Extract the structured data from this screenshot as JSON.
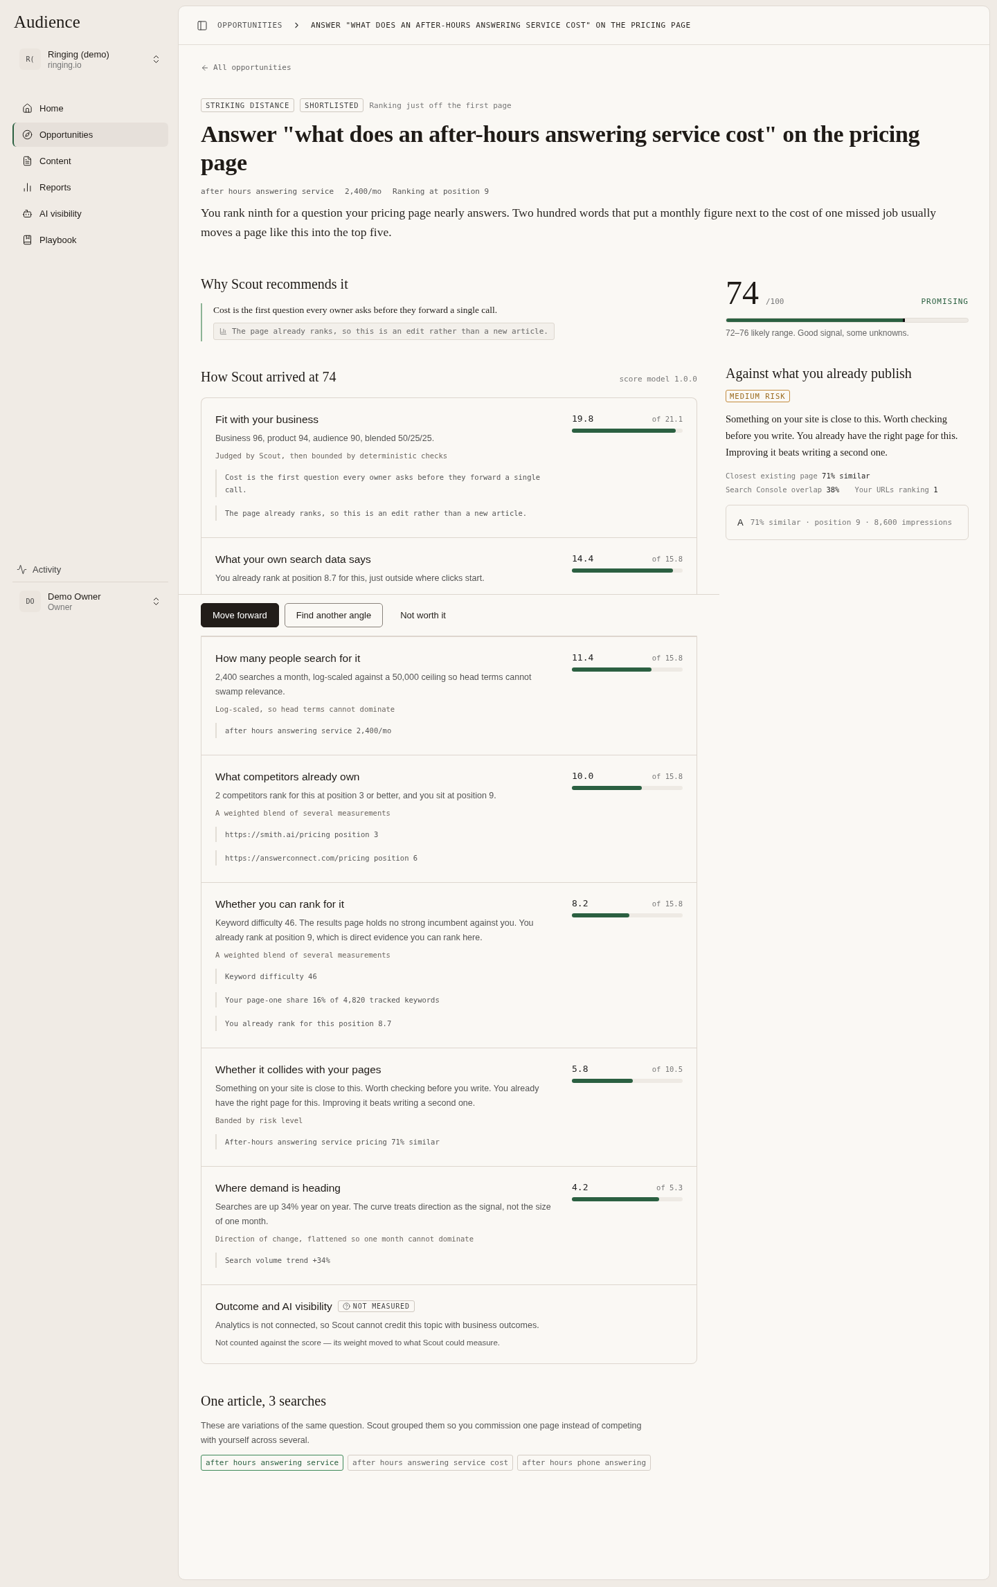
{
  "sidebar": {
    "brand": "Audience",
    "workspace": {
      "initials": "R(",
      "name": "Ringing (demo)",
      "domain": "ringing.io"
    },
    "nav": [
      {
        "label": "Home",
        "selected": false
      },
      {
        "label": "Opportunities",
        "selected": true
      },
      {
        "label": "Content",
        "selected": false
      },
      {
        "label": "Reports",
        "selected": false
      },
      {
        "label": "AI visibility",
        "selected": false
      },
      {
        "label": "Playbook",
        "selected": false
      }
    ],
    "activity": "Activity",
    "user": {
      "initials": "DO",
      "name": "Demo Owner",
      "role": "Owner"
    }
  },
  "breadcrumb": [
    "OPPORTUNITIES",
    "ANSWER \"WHAT DOES AN AFTER-HOURS ANSWERING SERVICE COST\" ON THE PRICING PAGE"
  ],
  "back_link": "All opportunities",
  "tags": [
    "STRIKING DISTANCE",
    "SHORTLISTED"
  ],
  "tag_note": "Ranking just off the first page",
  "title": "Answer \"what does an after-hours answering service cost\" on the pricing page",
  "meta": [
    "after hours answering service",
    "2,400/mo",
    "Ranking at position 9"
  ],
  "summary": "You rank ninth for a question your pricing page nearly answers. Two hundred words that put a monthly figure next to the cost of one missed job usually moves a page like this into the top five.",
  "why": {
    "heading": "Why Scout recommends it",
    "quote": "Cost is the first question every owner asks before they forward a single call.",
    "evidence": "The page already ranks, so this is an edit rather than a new article."
  },
  "breakdown": {
    "heading": "How Scout arrived at 74",
    "model": "score model 1.0.0",
    "factors_above": [
      {
        "kind": "scored",
        "title": "Fit with your business",
        "score": "19.8",
        "max": "of 21.1",
        "level": 0.94,
        "description": "Business 96, product 94, audience 90, blended 50/25/25.",
        "method": "Judged by Scout, then bounded by deterministic checks",
        "evidence": [
          "Cost is the first question every owner asks before they forward a single call.",
          "The page already ranks, so this is an edit rather than a new article."
        ]
      },
      {
        "kind": "scored",
        "title": "What your own search data says",
        "score": "14.4",
        "max": "of 15.8",
        "level": 0.91,
        "description": "You already rank at position 8.7 for this, just outside where clicks start."
      }
    ],
    "factors_below": [
      {
        "kind": "scored",
        "title": "How many people search for it",
        "score": "11.4",
        "max": "of 15.8",
        "level": 0.72,
        "description": "2,400 searches a month, log-scaled against a 50,000 ceiling so head terms cannot swamp relevance.",
        "method": "Log-scaled, so head terms cannot dominate",
        "evidence": [
          "after hours answering service 2,400/mo"
        ]
      },
      {
        "kind": "scored",
        "title": "What competitors already own",
        "score": "10.0",
        "max": "of 15.8",
        "level": 0.63,
        "description": "2 competitors rank for this at position 3 or better, and you sit at position 9.",
        "method": "A weighted blend of several measurements",
        "evidence": [
          "https://smith.ai/pricing position 3",
          "https://answerconnect.com/pricing position 6"
        ]
      },
      {
        "kind": "scored",
        "title": "Whether you can rank for it",
        "score": "8.2",
        "max": "of 15.8",
        "level": 0.52,
        "description": "Keyword difficulty 46. The results page holds no strong incumbent against you. You already rank at position 9, which is direct evidence you can rank here.",
        "method": "A weighted blend of several measurements",
        "evidence": [
          "Keyword difficulty 46",
          "Your page-one share 16% of 4,820 tracked keywords",
          "You already rank for this position 8.7"
        ]
      },
      {
        "kind": "scored",
        "title": "Whether it collides with your pages",
        "score": "5.8",
        "max": "of 10.5",
        "level": 0.55,
        "description": "Something on your site is close to this. Worth checking before you write. You already have the right page for this. Improving it beats writing a second one.",
        "method": "Banded by risk level",
        "evidence": [
          "After-hours answering service pricing 71% similar"
        ]
      },
      {
        "kind": "scored",
        "title": "Where demand is heading",
        "score": "4.2",
        "max": "of 5.3",
        "level": 0.79,
        "description": "Searches are up 34% year on year. The curve treats direction as the signal, not the size of one month.",
        "method": "Direction of change, flattened so one month cannot dominate",
        "evidence": [
          "Search volume trend +34%"
        ]
      },
      {
        "kind": "not_measured",
        "title": "Outcome and AI visibility",
        "badge": "NOT MEASURED",
        "description": "Analytics is not connected, so Scout cannot credit this topic with business outcomes.",
        "note": "Not counted against the score — its weight moved to what Scout could measure."
      }
    ]
  },
  "actions": [
    {
      "label": "Move forward",
      "kind": "primary"
    },
    {
      "label": "Find another angle",
      "kind": "outline"
    },
    {
      "label": "Not worth it",
      "kind": "ghost"
    }
  ],
  "cluster": {
    "heading": "One article, 3 searches",
    "description": "These are variations of the same question. Scout grouped them so you commission one page instead of competing with yourself across several.",
    "keywords": [
      {
        "label": "after hours answering service",
        "selected": true
      },
      {
        "label": "after hours answering service cost",
        "selected": false
      },
      {
        "label": "after hours phone answering",
        "selected": false
      }
    ]
  },
  "score": {
    "value": "74",
    "max": "/100",
    "verdict": "PROMISING",
    "level": 0.74,
    "range": "72–76 likely range. Good signal, some unknowns."
  },
  "overlap": {
    "heading": "Against what you already publish",
    "risk": "MEDIUM RISK",
    "description": "Something on your site is close to this. Worth checking before you write. You already have the right page for this. Improving it beats writing a second one.",
    "stats": [
      "Closest existing page **71% similar**",
      "Search Console overlap **38%**",
      "Your URLs ranking **1**"
    ],
    "page": {
      "grade": "A",
      "detail": "71% similar · position 9 · 8,600 impressions"
    }
  }
}
